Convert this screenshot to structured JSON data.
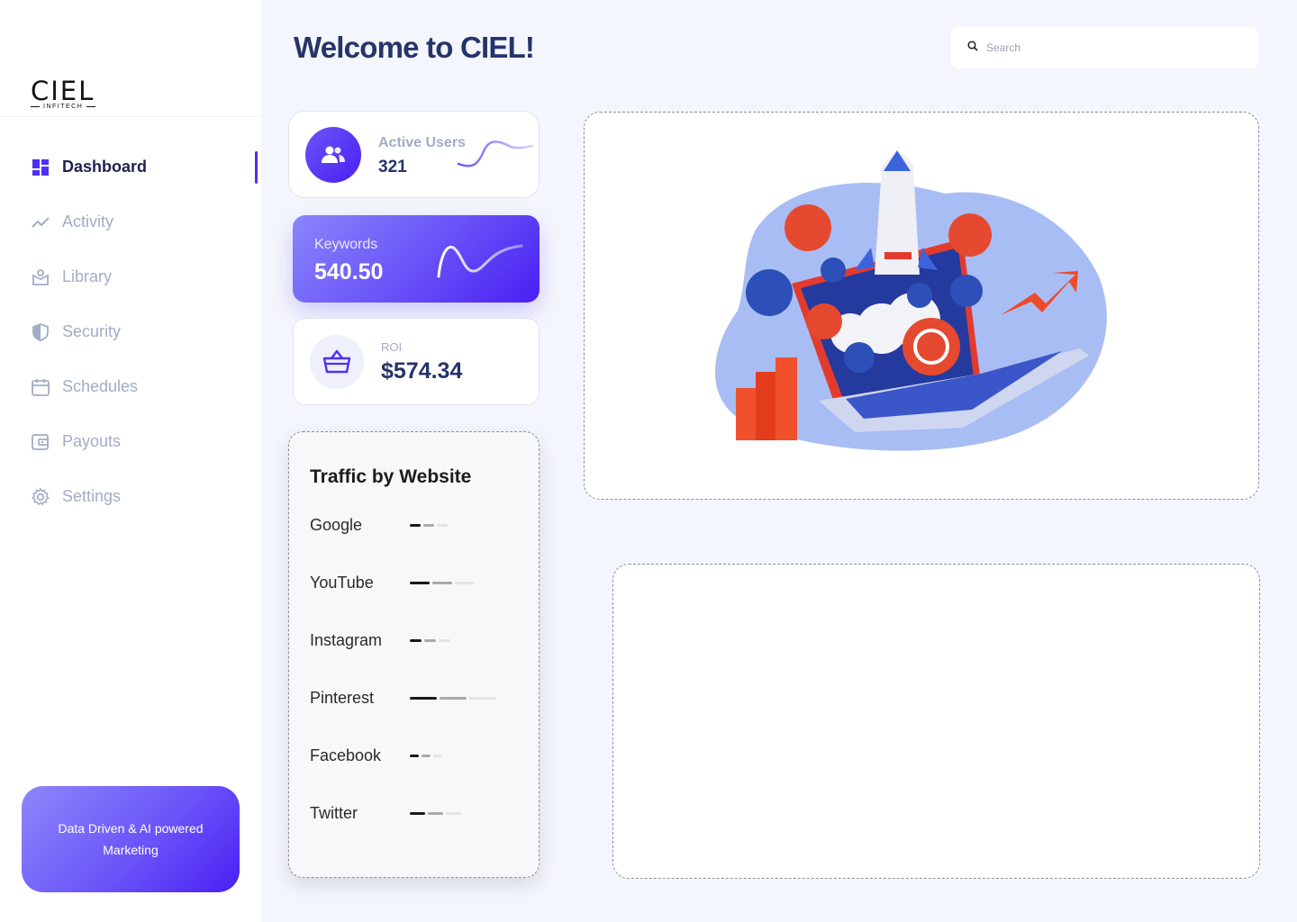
{
  "app": {
    "logo_text": "CIEL",
    "logo_subtext": "INFITECH"
  },
  "sidebar": {
    "items": [
      {
        "label": "Dashboard",
        "icon": "dashboard-icon",
        "active": true
      },
      {
        "label": "Activity",
        "icon": "activity-icon",
        "active": false
      },
      {
        "label": "Library",
        "icon": "library-icon",
        "active": false
      },
      {
        "label": "Security",
        "icon": "shield-icon",
        "active": false
      },
      {
        "label": "Schedules",
        "icon": "calendar-icon",
        "active": false
      },
      {
        "label": "Payouts",
        "icon": "wallet-icon",
        "active": false
      },
      {
        "label": "Settings",
        "icon": "gear-icon",
        "active": false
      }
    ],
    "promo_text": "Data Driven & AI powered Marketing"
  },
  "header": {
    "title": "Welcome to CIEL!",
    "search_placeholder": "Search"
  },
  "stats": {
    "active_users": {
      "label": "Active Users",
      "value": "321"
    },
    "keywords": {
      "label": "Keywords",
      "value": "540.50"
    },
    "roi": {
      "label": "ROI",
      "value": "$574.34"
    }
  },
  "traffic": {
    "title": "Traffic by Website",
    "sites": [
      {
        "name": "Google",
        "bar_fractions": [
          0.3,
          0.3,
          0.3
        ]
      },
      {
        "name": "YouTube",
        "bar_fractions": [
          0.55,
          0.55,
          0.55
        ]
      },
      {
        "name": "Instagram",
        "bar_fractions": [
          0.33,
          0.33,
          0.33
        ]
      },
      {
        "name": "Pinterest",
        "bar_fractions": [
          0.75,
          0.75,
          0.75
        ]
      },
      {
        "name": "Facebook",
        "bar_fractions": [
          0.25,
          0.25,
          0.25
        ]
      },
      {
        "name": "Twitter",
        "bar_fractions": [
          0.42,
          0.42,
          0.42
        ]
      }
    ]
  },
  "colors": {
    "accent": "#4f2ff5",
    "title": "#263469",
    "muted": "#a3acc6",
    "background": "#f4f6fd"
  }
}
